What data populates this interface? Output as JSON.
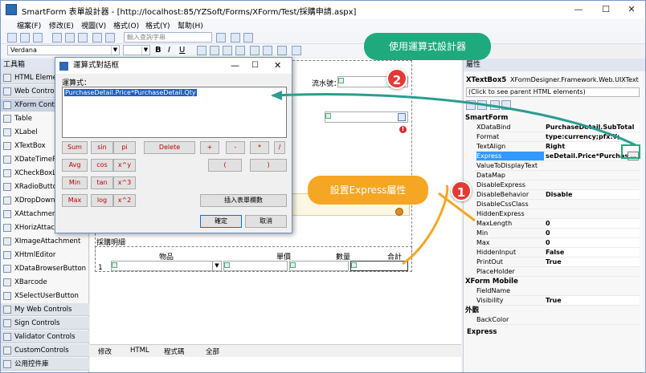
{
  "window": {
    "title": "SmartForm 表單設計器 - [http://localhost:85/YZSoft/Forms/XForm/Test/採購申請.aspx]",
    "minimize": "—",
    "maximize": "☐",
    "close": "✕"
  },
  "menu": [
    "檔案(F)",
    "修改(E)",
    "視圖(V)",
    "格式(O)",
    "格式(Y)",
    "幫助(H)"
  ],
  "toolbar": {
    "search_placeholder": "輸入查詢字串",
    "font_name": "Verdana",
    "bold": "B",
    "italic": "I",
    "underline": "U"
  },
  "toolbox": {
    "title": "工具箱",
    "items": [
      {
        "label": "HTML Element",
        "type": "cat"
      },
      {
        "label": "Web Controls",
        "type": "cat"
      },
      {
        "label": "XForm Contro",
        "type": "cat"
      },
      {
        "label": "Table",
        "type": "item"
      },
      {
        "label": "XLabel",
        "type": "item"
      },
      {
        "label": "XTextBox",
        "type": "item"
      },
      {
        "label": "XDateTimePick",
        "type": "item"
      },
      {
        "label": "XCheckBoxList",
        "type": "item"
      },
      {
        "label": "XRadioButton",
        "type": "item"
      },
      {
        "label": "XDropDownLis",
        "type": "item"
      },
      {
        "label": "XAttachments",
        "type": "item"
      },
      {
        "label": "XHorizAttachm",
        "type": "item"
      },
      {
        "label": "XImageAttachment",
        "type": "item"
      },
      {
        "label": "XHtmlEditor",
        "type": "item"
      },
      {
        "label": "XDataBrowserButton",
        "type": "item"
      },
      {
        "label": "XBarcode",
        "type": "item"
      },
      {
        "label": "XSelectUserButton",
        "type": "item"
      },
      {
        "label": "My Web Controls",
        "type": "cat"
      },
      {
        "label": "Sign Controls",
        "type": "cat"
      },
      {
        "label": "Validator Controls",
        "type": "cat"
      },
      {
        "label": "CustomControls",
        "type": "cat"
      },
      {
        "label": "公用控件庫",
        "type": "cat"
      }
    ]
  },
  "designer": {
    "serial_label": "流水號：",
    "detail_title": "採購明細",
    "col_item": "物品",
    "col_price": "單價",
    "col_qty": "數量",
    "col_total": "合計",
    "row_num": "1",
    "tabs": [
      "修改",
      "HTML",
      "程式碼",
      "全部"
    ]
  },
  "properties": {
    "title": "屬性",
    "object_name": "XTextBox5",
    "object_type": "XFormDesigner.Framework.Web.UIXTextBox",
    "parent_link": "(Click to see parent HTML elements)",
    "categories": [
      {
        "name": "SmartForm",
        "rows": [
          {
            "name": "XDataBind",
            "value": "PurchaseDetail.SubTotal"
          },
          {
            "name": "Format",
            "value": "type:currency;pfx:¥;"
          },
          {
            "name": "TextAlign",
            "value": "Right"
          },
          {
            "name": "Express",
            "value": "seDetail.Price*PurchaseD",
            "selected": true
          },
          {
            "name": "ValueToDisplayText",
            "value": ""
          },
          {
            "name": "DataMap",
            "value": ""
          },
          {
            "name": "DisableExpress",
            "value": ""
          },
          {
            "name": "DisableBehavior",
            "value": "Disable"
          },
          {
            "name": "DisableCssClass",
            "value": ""
          },
          {
            "name": "HiddenExpress",
            "value": ""
          },
          {
            "name": "MaxLength",
            "value": "0"
          },
          {
            "name": "Min",
            "value": "0"
          },
          {
            "name": "Max",
            "value": "0"
          },
          {
            "name": "HiddenInput",
            "value": "False"
          },
          {
            "name": "PrintOut",
            "value": "True"
          },
          {
            "name": "PlaceHolder",
            "value": ""
          }
        ]
      },
      {
        "name": "XForm Mobile",
        "rows": [
          {
            "name": "FieldName",
            "value": ""
          },
          {
            "name": "Visibility",
            "value": "True"
          }
        ]
      },
      {
        "name": "外觀",
        "rows": [
          {
            "name": "BackColor",
            "value": ""
          }
        ]
      }
    ],
    "description_title": "Express"
  },
  "dialog": {
    "title": "運算式對話框",
    "label": "運算式：",
    "expression": "PurchaseDetail.Price*PurchaseDetail.Qty",
    "buttons": {
      "sum": "Sum",
      "sin": "sin",
      "pi": "pi",
      "delete": "Delete",
      "plus": "+",
      "minus": "-",
      "mul": "*",
      "div": "/",
      "avg": "Avg",
      "cos": "cos",
      "xy": "x^y",
      "lparen": "(",
      "rparen": ")",
      "min": "Min",
      "tan": "tan",
      "x3": "x^3",
      "max": "Max",
      "log": "log",
      "x2": "x^2",
      "insert_field": "插入表單欄數",
      "ok": "確定",
      "cancel": "取消"
    }
  },
  "annotations": {
    "bubble1": "設置Express屬性",
    "bubble2": "使用運算式設計器",
    "num1": "1",
    "num2": "2"
  },
  "colors": {
    "bubble1": "#f5a623",
    "bubble2": "#1eaa7c",
    "arrow": "#2a9d8f",
    "highlight": "#1f5fbf"
  }
}
